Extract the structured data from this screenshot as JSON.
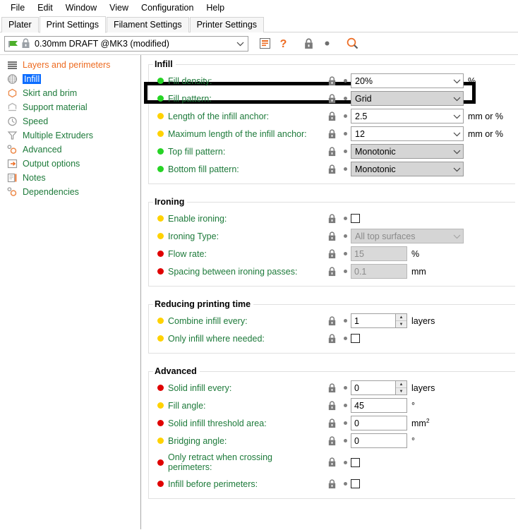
{
  "menu": {
    "items": [
      "File",
      "Edit",
      "Window",
      "View",
      "Configuration",
      "Help"
    ]
  },
  "tabs": [
    {
      "label": "Plater",
      "active": false
    },
    {
      "label": "Print Settings",
      "active": true
    },
    {
      "label": "Filament Settings",
      "active": false
    },
    {
      "label": "Printer Settings",
      "active": false
    }
  ],
  "preset": {
    "value": "0.30mm DRAFT @MK3 (modified)",
    "flag_color": "#4caf2a",
    "save_icon": "save-preset-icon",
    "help_icon": "question-mark-icon",
    "lock_icon": "lock-icon",
    "search_icon": "search-icon"
  },
  "sidebar": {
    "items": [
      {
        "label": "Layers and perimeters",
        "icon": "layers-icon",
        "state": "modified",
        "selected": false
      },
      {
        "label": "Infill",
        "icon": "infill-icon",
        "state": "normal",
        "selected": true
      },
      {
        "label": "Skirt and brim",
        "icon": "skirt-icon",
        "state": "normal",
        "selected": false
      },
      {
        "label": "Support material",
        "icon": "support-icon",
        "state": "normal",
        "selected": false
      },
      {
        "label": "Speed",
        "icon": "speed-clock-icon",
        "state": "normal",
        "selected": false
      },
      {
        "label": "Multiple Extruders",
        "icon": "extruders-icon",
        "state": "normal",
        "selected": false
      },
      {
        "label": "Advanced",
        "icon": "gear-icon",
        "state": "normal",
        "selected": false
      },
      {
        "label": "Output options",
        "icon": "output-icon",
        "state": "normal",
        "selected": false
      },
      {
        "label": "Notes",
        "icon": "notes-icon",
        "state": "normal",
        "selected": false
      },
      {
        "label": "Dependencies",
        "icon": "dependencies-icon",
        "state": "normal",
        "selected": false
      }
    ]
  },
  "colors": {
    "accent_orange": "#ed6b21",
    "label_green": "#1d7a3a",
    "bullet_green": "#26d425",
    "bullet_yellow": "#ffd200",
    "bullet_red": "#e00000",
    "selection_blue": "#0a6cff",
    "highlight_box": "#000000"
  },
  "groups": {
    "infill": {
      "title": "Infill",
      "rows": [
        {
          "label": "Fill density:",
          "bullet": "green",
          "control": "combo-edit",
          "value": "20%",
          "unit": "%"
        },
        {
          "label": "Fill pattern:",
          "bullet": "green",
          "control": "combo-readonly",
          "value": "Grid",
          "unit": "",
          "highlighted": true
        },
        {
          "label": "Length of the infill anchor:",
          "bullet": "yellow",
          "control": "combo-edit",
          "value": "2.5",
          "unit": "mm or %"
        },
        {
          "label": "Maximum length of the infill anchor:",
          "bullet": "yellow",
          "control": "combo-edit",
          "value": "12",
          "unit": "mm or %"
        },
        {
          "label": "Top fill pattern:",
          "bullet": "green",
          "control": "combo-readonly",
          "value": "Monotonic",
          "unit": ""
        },
        {
          "label": "Bottom fill pattern:",
          "bullet": "green",
          "control": "combo-readonly",
          "value": "Monotonic",
          "unit": ""
        }
      ]
    },
    "ironing": {
      "title": "Ironing",
      "rows": [
        {
          "label": "Enable ironing:",
          "bullet": "yellow",
          "control": "checkbox",
          "value": "",
          "checked": false,
          "unit": ""
        },
        {
          "label": "Ironing Type:",
          "bullet": "yellow",
          "control": "combo-disabled",
          "value": "All top surfaces",
          "unit": ""
        },
        {
          "label": "Flow rate:",
          "bullet": "red",
          "control": "text-disabled",
          "value": "15",
          "unit": "%"
        },
        {
          "label": "Spacing between ironing passes:",
          "bullet": "red",
          "control": "text-disabled",
          "value": "0.1",
          "unit": "mm"
        }
      ]
    },
    "reducing": {
      "title": "Reducing printing time",
      "rows": [
        {
          "label": "Combine infill every:",
          "bullet": "yellow",
          "control": "spin",
          "value": "1",
          "unit": "layers"
        },
        {
          "label": "Only infill where needed:",
          "bullet": "yellow",
          "control": "checkbox",
          "value": "",
          "checked": false,
          "unit": ""
        }
      ]
    },
    "advanced": {
      "title": "Advanced",
      "rows": [
        {
          "label": "Solid infill every:",
          "bullet": "red",
          "control": "spin",
          "value": "0",
          "unit": "layers"
        },
        {
          "label": "Fill angle:",
          "bullet": "yellow",
          "control": "text",
          "value": "45",
          "unit": "°"
        },
        {
          "label": "Solid infill threshold area:",
          "bullet": "red",
          "control": "text",
          "value": "0",
          "unit": "mm2"
        },
        {
          "label": "Bridging angle:",
          "bullet": "yellow",
          "control": "text",
          "value": "0",
          "unit": "°"
        },
        {
          "label": "Only retract when crossing perimeters:",
          "bullet": "red",
          "control": "checkbox",
          "value": "",
          "checked": false,
          "unit": "",
          "twoline": true
        },
        {
          "label": "Infill before perimeters:",
          "bullet": "red",
          "control": "checkbox",
          "value": "",
          "checked": false,
          "unit": ""
        }
      ]
    }
  }
}
